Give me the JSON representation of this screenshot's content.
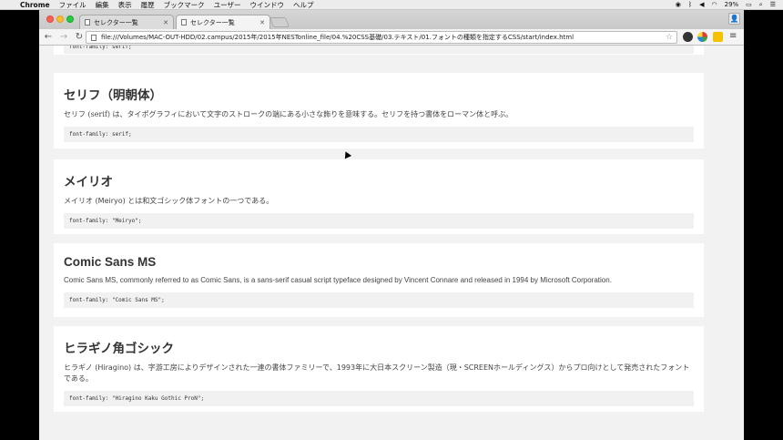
{
  "menubar": {
    "apple": "",
    "app": "Chrome",
    "items": [
      "ファイル",
      "編集",
      "表示",
      "履歴",
      "ブックマーク",
      "ユーザー",
      "ウインドウ",
      "ヘルプ"
    ],
    "battery": "29%"
  },
  "tabs": [
    {
      "label": "セレクター一覧",
      "active": false
    },
    {
      "label": "セレクター一覧",
      "active": true
    }
  ],
  "toolbar": {
    "url": "file:///Volumes/MAC-OUT-HDD/02.campus/2015年/2015年NESTonline_file/04.%20CSS基礎/03.テキスト/01.フォントの種類を指定するCSS/start/index.html"
  },
  "page": {
    "top_code": "font-family: serif;",
    "cards": [
      {
        "title": "セリフ（明朝体）",
        "description": "セリフ (serif) は、タイポグラフィにおいて文字のストロークの端にある小さな飾りを意味する。セリフを持つ書体をローマン体と呼ぶ。",
        "code": "font-family: serif;"
      },
      {
        "title": "メイリオ",
        "description": "メイリオ (Meiryo) とは和文ゴシック体フォントの一つである。",
        "code": "font-family: \"Meiryo\";"
      },
      {
        "title": "Comic Sans MS",
        "description": "Comic Sans MS, commonly referred to as Comic Sans, is a sans-serif casual script typeface designed by Vincent Connare and released in 1994 by Microsoft Corporation.",
        "code": "font-family: \"Comic Sans MS\";"
      },
      {
        "title": "ヒラギノ角ゴシック",
        "description": "ヒラギノ (Hiragino) は、字游工房によりデザインされた一連の書体ファミリーで、1993年に大日本スクリーン製造（現・SCREENホールディングス）からプロ向けとして発売されたフォントである。",
        "code": "font-family: \"Hiragino Kaku Gothic ProN\";"
      }
    ]
  }
}
